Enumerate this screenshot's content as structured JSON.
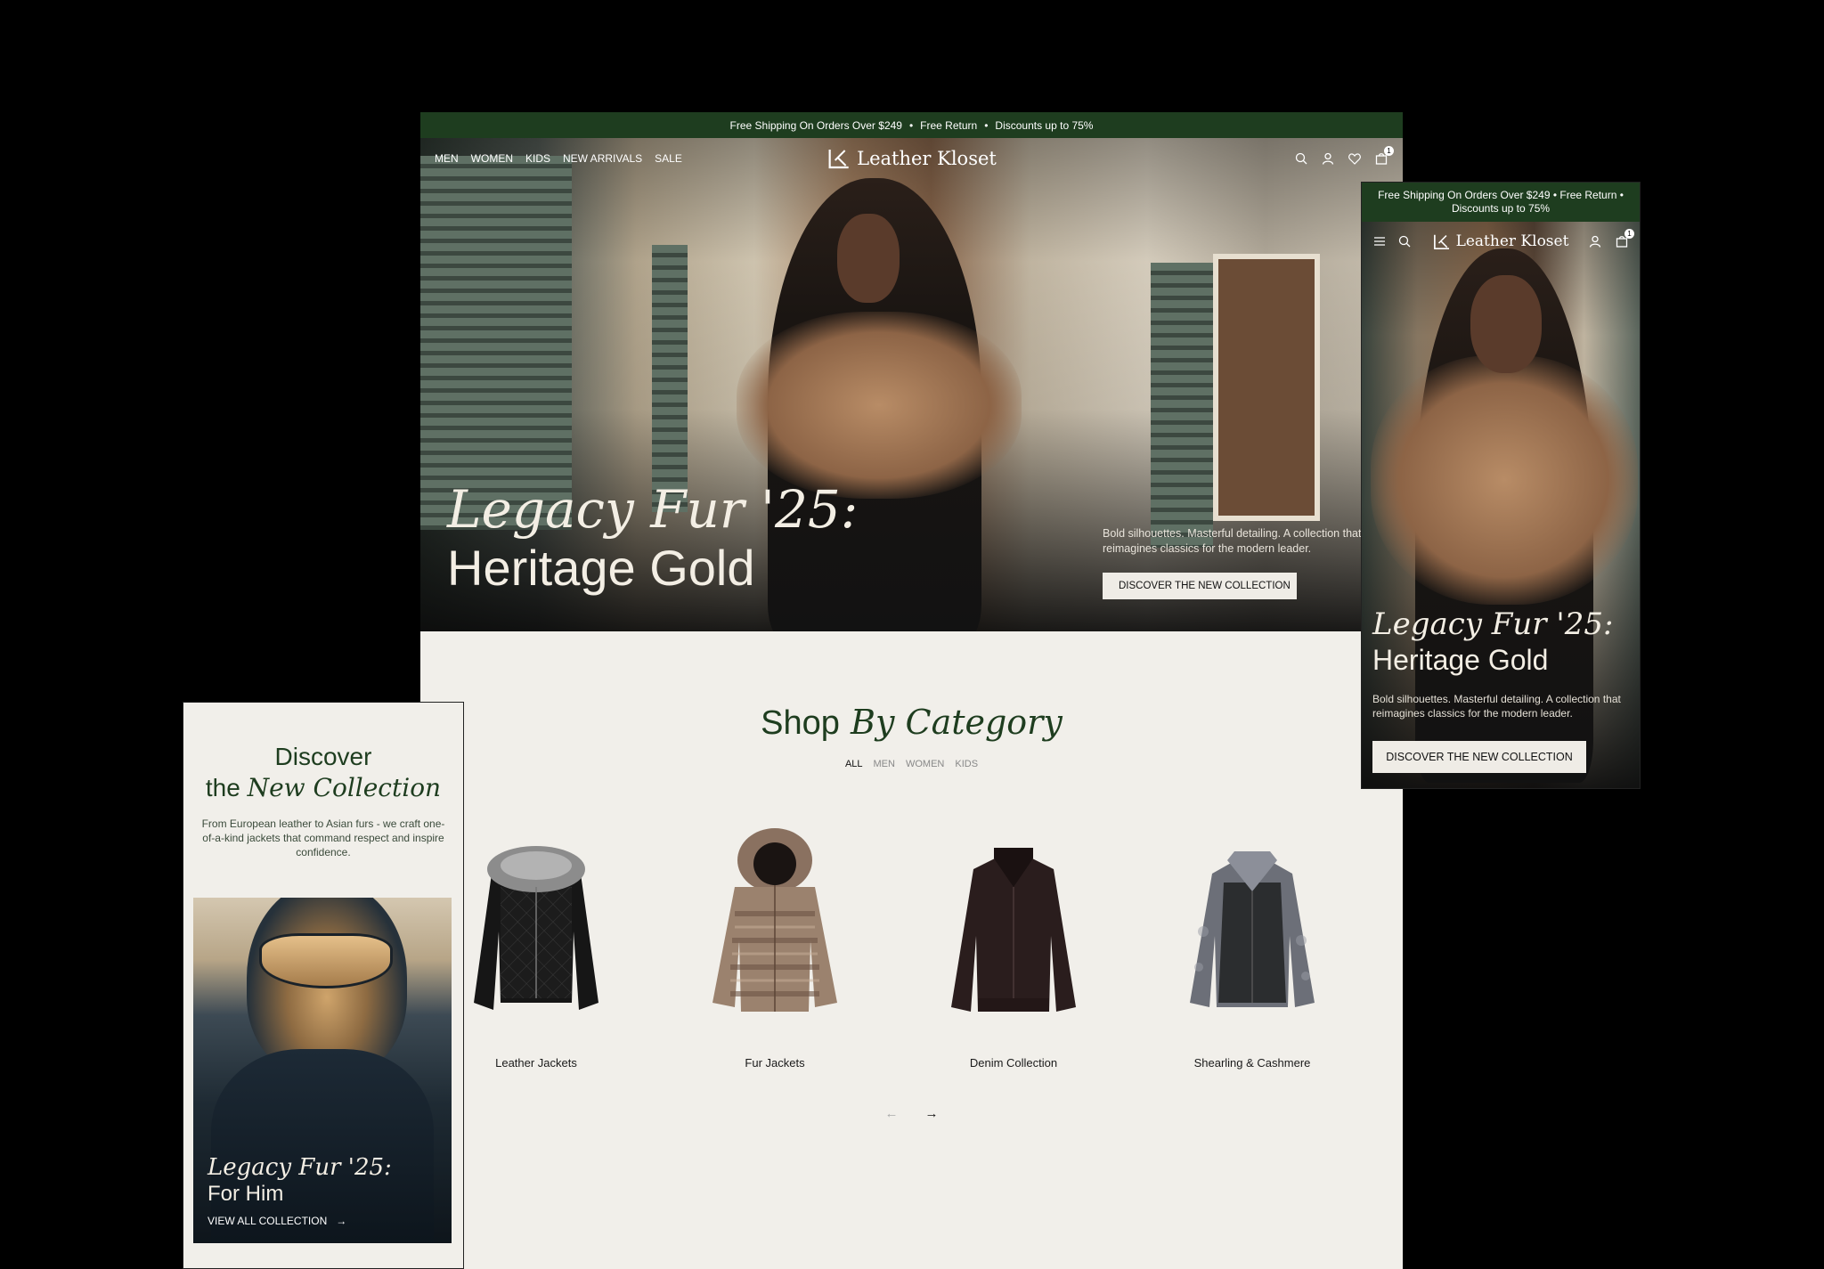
{
  "desktop": {
    "announcement": {
      "items": [
        "Free Shipping On Orders Over $249",
        "Free Return",
        "Discounts up to 75%"
      ],
      "separator": "•"
    },
    "nav": {
      "links": [
        "MEN",
        "WOMEN",
        "KIDS",
        "NEW ARRIVALS",
        "SALE"
      ],
      "brand": "Leather Kloset",
      "icons": [
        "search-icon",
        "account-icon",
        "wishlist-icon",
        "cart-icon"
      ],
      "cart_count": "1"
    },
    "hero": {
      "title_line1": "Legacy Fur '25:",
      "title_line2": "Heritage Gold",
      "description": "Bold silhouettes. Masterful detailing. A collection that reimagines classics for the modern leader.",
      "cta": "DISCOVER THE NEW COLLECTION"
    },
    "shop": {
      "title_plain": "Shop",
      "title_italic": "By Category",
      "filters": [
        "ALL",
        "MEN",
        "WOMEN",
        "KIDS"
      ],
      "active_filter": "ALL",
      "products": [
        {
          "name": "Leather Jackets"
        },
        {
          "name": "Fur Jackets"
        },
        {
          "name": "Denim Collection"
        },
        {
          "name": "Shearling & Cashmere"
        }
      ],
      "prev_arrow": "←",
      "next_arrow": "→"
    }
  },
  "mobile_left": {
    "heading_line1": "Discover",
    "heading_line2_plain": "the",
    "heading_line2_italic": "New Collection",
    "description": "From European leather to Asian furs - we craft one-of-a-kind jackets that command respect and inspire confidence.",
    "card": {
      "title_line1": "Legacy Fur '25:",
      "title_line2": "For Him",
      "link": "VIEW ALL COLLECTION",
      "link_arrow": "→"
    }
  },
  "mobile_right": {
    "announcement": "Free Shipping On Orders Over $249 • Free Return • Discounts up to 75%",
    "brand": "Leather Kloset",
    "icons": [
      "menu-icon",
      "search-icon",
      "account-icon",
      "cart-icon"
    ],
    "cart_count": "1",
    "hero": {
      "title_line1": "Legacy Fur '25:",
      "title_line2": "Heritage Gold",
      "description": "Bold silhouettes. Masterful detailing. A collection that reimagines classics for the modern leader.",
      "cta": "DISCOVER THE NEW COLLECTION"
    }
  },
  "colors": {
    "brand_green": "#1e3d1f",
    "page_bg": "#f1efea",
    "outer_bg": "#000000"
  }
}
